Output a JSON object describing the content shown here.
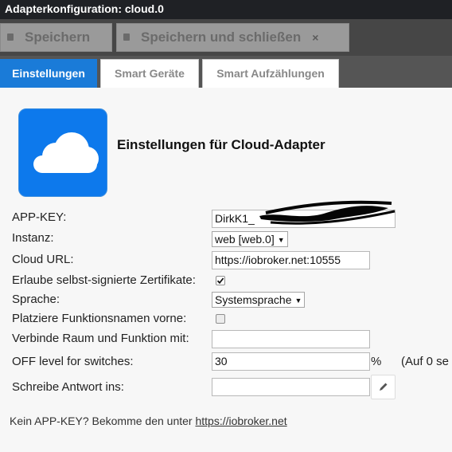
{
  "window": {
    "title": "Adapterkonfiguration: cloud.0"
  },
  "toolbar": {
    "save_label": "Speichern",
    "save_close_label": "Speichern und schließen",
    "close_label": "×"
  },
  "tabs": [
    {
      "label": "Einstellungen",
      "active": true
    },
    {
      "label": "Smart Geräte",
      "active": false
    },
    {
      "label": "Smart Aufzählungen",
      "active": false
    }
  ],
  "settings": {
    "heading": "Einstellungen für Cloud-Adapter",
    "app_key": {
      "label": "APP-KEY:",
      "value": "DirkK1_"
    },
    "instance": {
      "label": "Instanz:",
      "value": "web [web.0]"
    },
    "cloud_url": {
      "label": "Cloud URL:",
      "value": "https://iobroker.net:10555"
    },
    "self_signed": {
      "label": "Erlaube selbst-signierte Zertifikate:",
      "checked": true
    },
    "language": {
      "label": "Sprache:",
      "value": "Systemsprache"
    },
    "function_first": {
      "label": "Platziere Funktionsnamen vorne:",
      "checked": false
    },
    "concat_word": {
      "label": "Verbinde Raum und Funktion mit:",
      "value": ""
    },
    "off_level": {
      "label": "OFF level for switches:",
      "value": "30",
      "unit": "%",
      "hint": "(Auf 0 se"
    },
    "response_to": {
      "label": "Schreibe Antwort ins:",
      "value": ""
    }
  },
  "footer": {
    "text": "Kein APP-KEY? Bekomme den unter ",
    "link": "https://iobroker.net"
  },
  "colors": {
    "accent": "#1a7bd8",
    "logo_bg": "#0d79ec",
    "toolbar_bg": "#464646",
    "titlebar_bg": "#1f2125"
  },
  "icons": {
    "save": "floppy-icon",
    "close": "close-icon",
    "edit": "pencil-icon",
    "logo": "cloud-icon",
    "check": "checkmark-icon"
  }
}
